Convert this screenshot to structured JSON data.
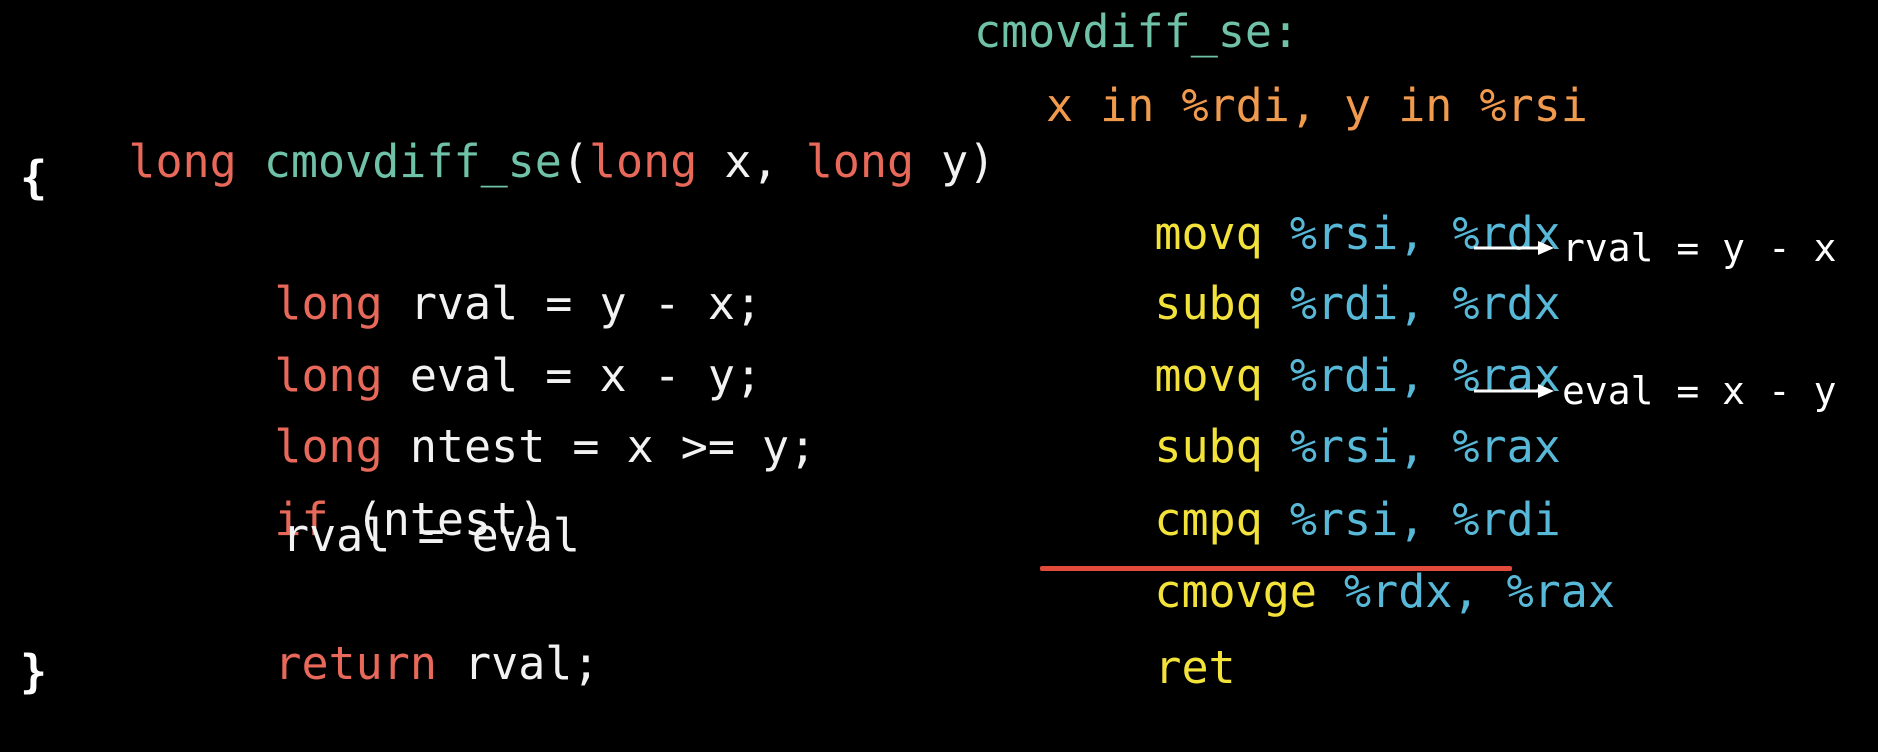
{
  "c_code": {
    "signature": {
      "ret_type": "long",
      "func_name": "cmovdiff_se",
      "open_paren": "(",
      "param1_type": "long",
      "param1_name": " x, ",
      "param2_type": "long",
      "param2_name": " y)"
    },
    "open_brace": "{",
    "line_rval": {
      "type": "long",
      "rest": " rval = y - x;"
    },
    "line_eval": {
      "type": "long",
      "rest": " eval = x - y;"
    },
    "line_ntest": {
      "type": "long",
      "rest": " ntest = x >= y;"
    },
    "line_if": {
      "keyword": "if",
      "rest": " (ntest)"
    },
    "line_assign": "rval = eval",
    "line_return": {
      "keyword": "return",
      "rest": " rval;"
    },
    "close_brace": "}"
  },
  "assembly": {
    "label": "cmovdiff_se:",
    "arg_note": "x in %rdi, y in %rsi",
    "instructions": [
      {
        "op": "movq",
        "operands": " %rsi, %rdx"
      },
      {
        "op": "subq",
        "operands": " %rdi, %rdx",
        "note": "rval = y - x"
      },
      {
        "op": "movq",
        "operands": " %rdi, %rax"
      },
      {
        "op": "subq",
        "operands": " %rsi, %rax",
        "note": "eval = x - y"
      },
      {
        "op": "cmpq",
        "operands": " %rsi, %rdi"
      },
      {
        "op": "cmovge",
        "operands": " %rdx, %rax",
        "highlighted": true
      },
      {
        "op": "ret",
        "operands": ""
      }
    ]
  },
  "colors": {
    "background": "#000000",
    "keyword": "#e8685a",
    "function_name": "#6fc2a8",
    "plain_text": "#f2f2f2",
    "arg_annotation": "#f09a4e",
    "instruction": "#f2e23a",
    "register": "#58b8d8",
    "highlight_underline": "#e24a3b"
  }
}
